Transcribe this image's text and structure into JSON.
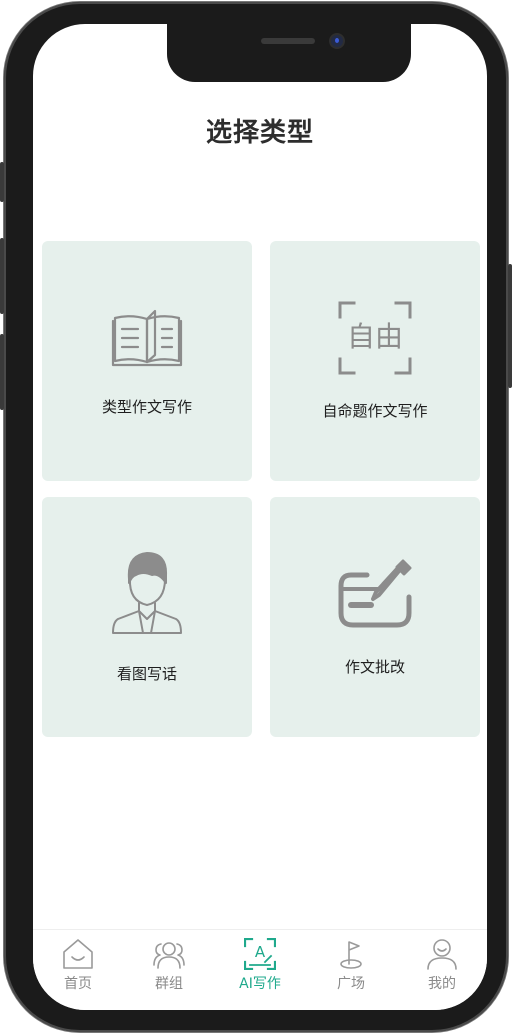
{
  "page": {
    "title": "选择类型"
  },
  "cards": [
    {
      "label": "类型作文写作",
      "icon": "open-book-icon"
    },
    {
      "label": "自命题作文写作",
      "icon": "free-topic-frame-icon",
      "icon_text": "自由"
    },
    {
      "label": "看图写话",
      "icon": "person-avatar-icon"
    },
    {
      "label": "作文批改",
      "icon": "pen-correction-icon"
    }
  ],
  "tabbar": {
    "items": [
      {
        "label": "首页",
        "icon": "home-icon",
        "active": false
      },
      {
        "label": "群组",
        "icon": "group-icon",
        "active": false
      },
      {
        "label": "AI写作",
        "icon": "ai-writing-icon",
        "icon_text": "A",
        "active": true
      },
      {
        "label": "广场",
        "icon": "plaza-flag-icon",
        "active": false
      },
      {
        "label": "我的",
        "icon": "profile-icon",
        "active": false
      }
    ]
  },
  "colors": {
    "accent": "#1fa98c",
    "card_background": "#e6f0ec",
    "icon_gray": "#8c8c8c",
    "tab_inactive": "#8a8a8a",
    "title_text": "#2d2d2d"
  }
}
